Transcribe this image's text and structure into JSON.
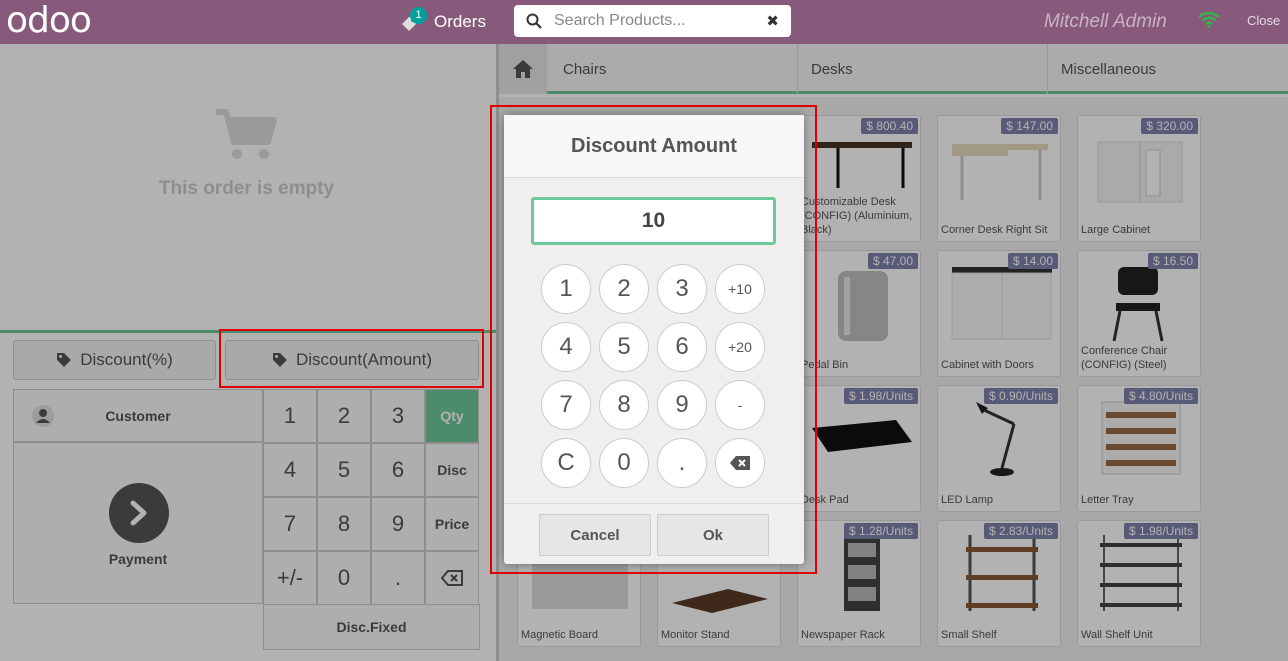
{
  "header": {
    "logo": "odoo",
    "orders_label": "Orders",
    "orders_count": "1",
    "search_placeholder": "Search Products...",
    "user": "Mitchell Admin",
    "close_label": "Close"
  },
  "order": {
    "empty_text": "This order is empty"
  },
  "discount": {
    "percent_label": "Discount(%)",
    "amount_label": "Discount(Amount)"
  },
  "control": {
    "customer_label": "Customer",
    "payment_label": "Payment",
    "keys": [
      "1",
      "2",
      "3",
      "4",
      "5",
      "6",
      "7",
      "8",
      "9",
      "+/-",
      "0",
      "."
    ],
    "modes": {
      "qty": "Qty",
      "disc": "Disc",
      "price": "Price"
    },
    "disc_fixed": "Disc.Fixed"
  },
  "categories": [
    "Chairs",
    "Desks",
    "Miscellaneous"
  ],
  "products": [
    {
      "name": "Customizable Desk (CONFIG) (Aluminium, Black)",
      "price": "$ 800.40"
    },
    {
      "name": "Corner Desk Right Sit",
      "price": "$ 147.00"
    },
    {
      "name": "Large Cabinet",
      "price": "$ 320.00"
    },
    {
      "name": "Pedal Bin",
      "price": "$ 47.00"
    },
    {
      "name": "Cabinet with Doors",
      "price": "$ 14.00"
    },
    {
      "name": "Conference Chair (CONFIG) (Steel)",
      "price": "$ 16.50"
    },
    {
      "name": "Desk Pad",
      "price": "$ 1.98/Units"
    },
    {
      "name": "LED Lamp",
      "price": "$ 0.90/Units"
    },
    {
      "name": "Letter Tray",
      "price": "$ 4.80/Units"
    },
    {
      "name": "Magnetic Board",
      "price": ""
    },
    {
      "name": "Monitor Stand",
      "price": ""
    },
    {
      "name": "Newspaper Rack",
      "price": "$ 1.28/Units"
    },
    {
      "name": "Small Shelf",
      "price": "$ 2.83/Units"
    },
    {
      "name": "Wall Shelf Unit",
      "price": "$ 1.98/Units"
    }
  ],
  "modal": {
    "title": "Discount Amount",
    "value": "10",
    "keys": [
      "1",
      "2",
      "3",
      "+10",
      "4",
      "5",
      "6",
      "+20",
      "7",
      "8",
      "9",
      "-",
      "C",
      "0",
      "."
    ],
    "cancel_label": "Cancel",
    "ok_label": "Ok"
  },
  "colors": {
    "header": "#875a7b",
    "accent": "#6ec89b",
    "price_tag": "#7f82ac",
    "highlight": "#e00000"
  }
}
